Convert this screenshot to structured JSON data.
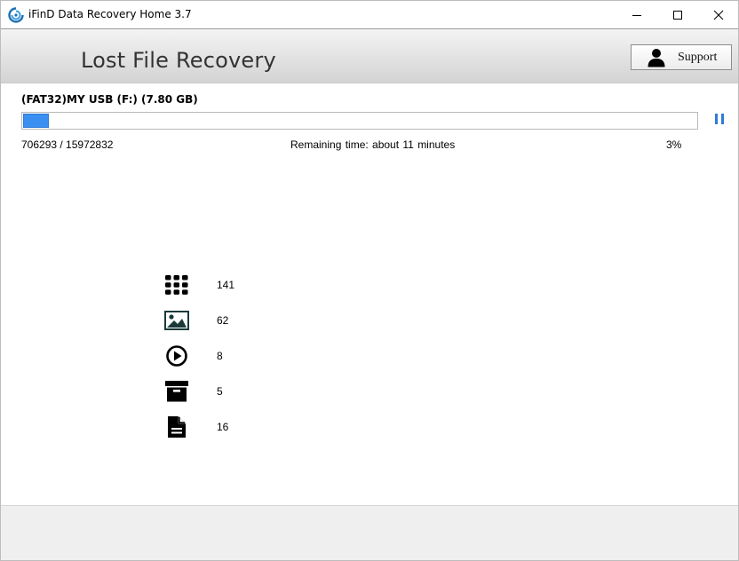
{
  "window": {
    "title": "iFinD Data Recovery Home 3.7",
    "icon": "app-logo-icon",
    "controls": [
      "minimize-icon",
      "maximize-icon",
      "close-icon"
    ]
  },
  "header": {
    "title": "Lost File Recovery",
    "support_label": "Support",
    "support_icon": "user-icon"
  },
  "scan": {
    "drive_label": "(FAT32)MY USB (F:) (7.80 GB)",
    "progress_percent": 3,
    "count_text": "706293 / 15972832",
    "remaining_text": "Remaining time:  about  11  minutes",
    "percent_text": "3%",
    "pause_icon": "pause-icon",
    "accent_color": "#3b8ff0"
  },
  "categories": [
    {
      "icon": "all-files-grid-icon",
      "count": "141"
    },
    {
      "icon": "image-icon",
      "count": "62"
    },
    {
      "icon": "video-play-icon",
      "count": "8"
    },
    {
      "icon": "archive-icon",
      "count": "5"
    },
    {
      "icon": "document-icon",
      "count": "16"
    }
  ]
}
